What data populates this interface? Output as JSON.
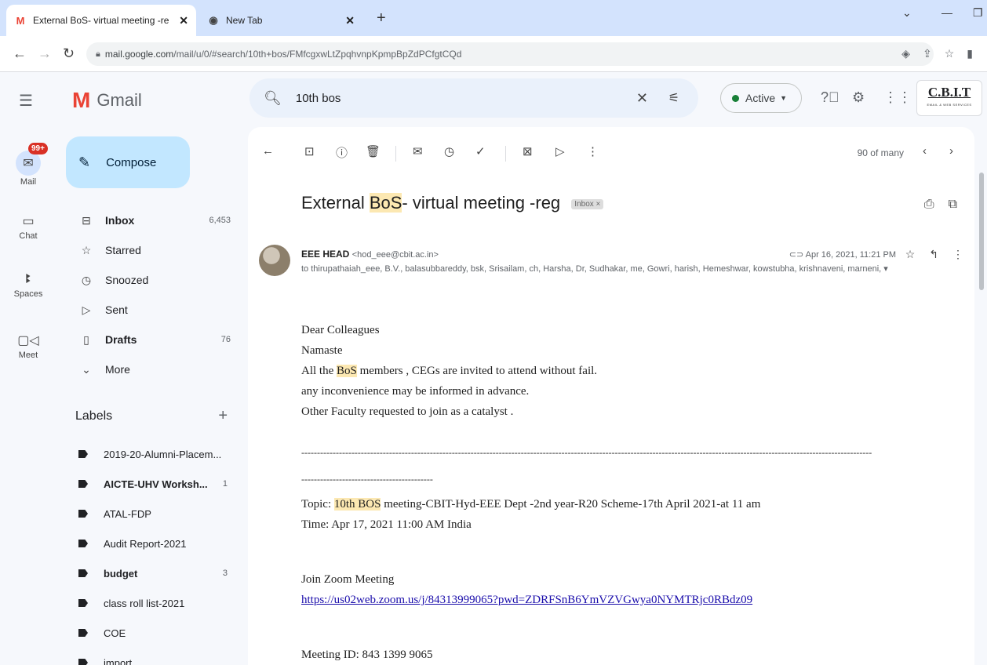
{
  "browser": {
    "tabs": [
      {
        "title": "External BoS- virtual meeting -re",
        "close": "✕"
      },
      {
        "title": "New Tab",
        "close": "✕"
      }
    ],
    "new_tab": "+",
    "url_host": "mail.google.com",
    "url_path": "/mail/u/0/#search/10th+bos/FMfcgxwLtZpqhvnpKpmpBpZdPCfgtCQd"
  },
  "header": {
    "app_name": "Gmail",
    "search_value": "10th bos",
    "status_label": "Active",
    "org_badge": "C.B.I.T",
    "org_badge_sub": "EMAIL & WEB SERVICES"
  },
  "rail": {
    "mail_label": "Mail",
    "mail_badge": "99+",
    "chat_label": "Chat",
    "spaces_label": "Spaces",
    "meet_label": "Meet"
  },
  "nav": {
    "compose_label": "Compose",
    "items": [
      {
        "label": "Inbox",
        "count": "6,453"
      },
      {
        "label": "Starred",
        "count": ""
      },
      {
        "label": "Snoozed",
        "count": ""
      },
      {
        "label": "Sent",
        "count": ""
      },
      {
        "label": "Drafts",
        "count": "76"
      },
      {
        "label": "More",
        "count": ""
      }
    ],
    "labels_title": "Labels",
    "labels": [
      {
        "label": "2019-20-Alumni-Placem...",
        "count": ""
      },
      {
        "label": "AICTE-UHV Worksh...",
        "count": "1"
      },
      {
        "label": "ATAL-FDP",
        "count": ""
      },
      {
        "label": "Audit Report-2021",
        "count": ""
      },
      {
        "label": "budget",
        "count": "3"
      },
      {
        "label": "class roll list-2021",
        "count": ""
      },
      {
        "label": "COE",
        "count": ""
      },
      {
        "label": "import",
        "count": ""
      }
    ]
  },
  "toolbar": {
    "pager": "90 of many"
  },
  "email": {
    "subject_pre": "External ",
    "subject_hl": "BoS",
    "subject_post": "- virtual meeting -reg",
    "inbox_tag": "Inbox ×",
    "sender_name": "EEE HEAD",
    "sender_email": "<hod_eee@cbit.ac.in>",
    "recipients": "to thirupathaiah_eee, B.V., balasubbareddy, bsk, Srisailam, ch, Harsha, Dr, Sudhakar, me, Gowri, harish, Hemeshwar, kowstubha, krishnaveni, marneni, ▾",
    "date": "Apr 16, 2021, 11:21 PM",
    "body": {
      "greeting": "Dear Colleagues",
      "namaste": "Namaste",
      "line1_pre": "All the ",
      "line1_hl": "BoS",
      "line1_post": " members , CEGs are invited to  attend without fail.",
      "line2": "any inconvenience may be informed in advance.",
      "line3": "Other Faculty requested to join  as  a catalyst .",
      "dashes_long": "--------------------------------------------------------------------------------------------------------------------------------------------------------------------------------------",
      "dashes_short": "------------------------------------------",
      "topic_pre": "Topic: ",
      "topic_hl": "10th BOS",
      "topic_post": " meeting-CBIT-Hyd-EEE Dept -2nd year-R20 Scheme-17th April 2021-at 11 am",
      "time": "Time: Apr 17, 2021 11:00 AM India",
      "join": "Join Zoom Meeting",
      "zoom_link": "https://us02web.zoom.us/j/84313999065?pwd=ZDRFSnB6YmVZVGwya0NYMTRjc0RBdz09",
      "meeting_id": "Meeting ID: 843 1399 9065"
    }
  }
}
